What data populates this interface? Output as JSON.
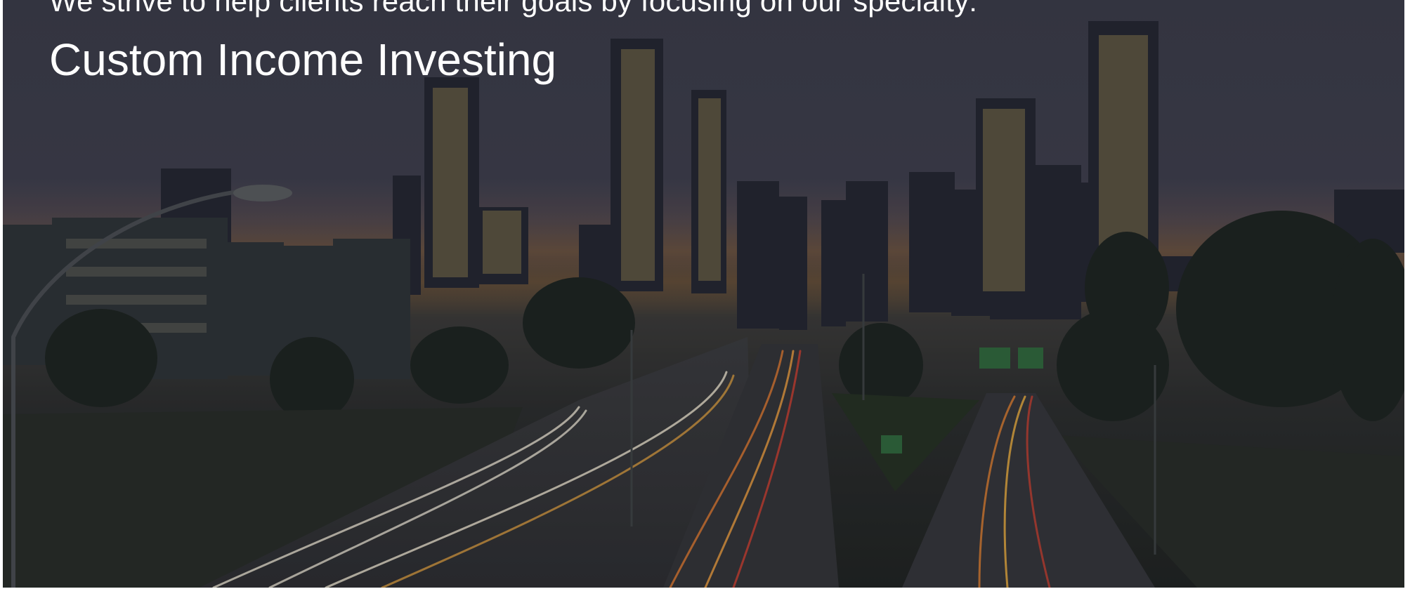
{
  "hero": {
    "tagline": "We strive to help clients reach their goals by focusing on our specialty:",
    "specialty": "Custom Income Investing",
    "background_image": "city-skyline-highway-night-photo"
  },
  "colors": {
    "text": "#ffffff",
    "sky": "#3d3e4c",
    "horizon_glow": "#6b5238",
    "ground": "#252a26"
  }
}
